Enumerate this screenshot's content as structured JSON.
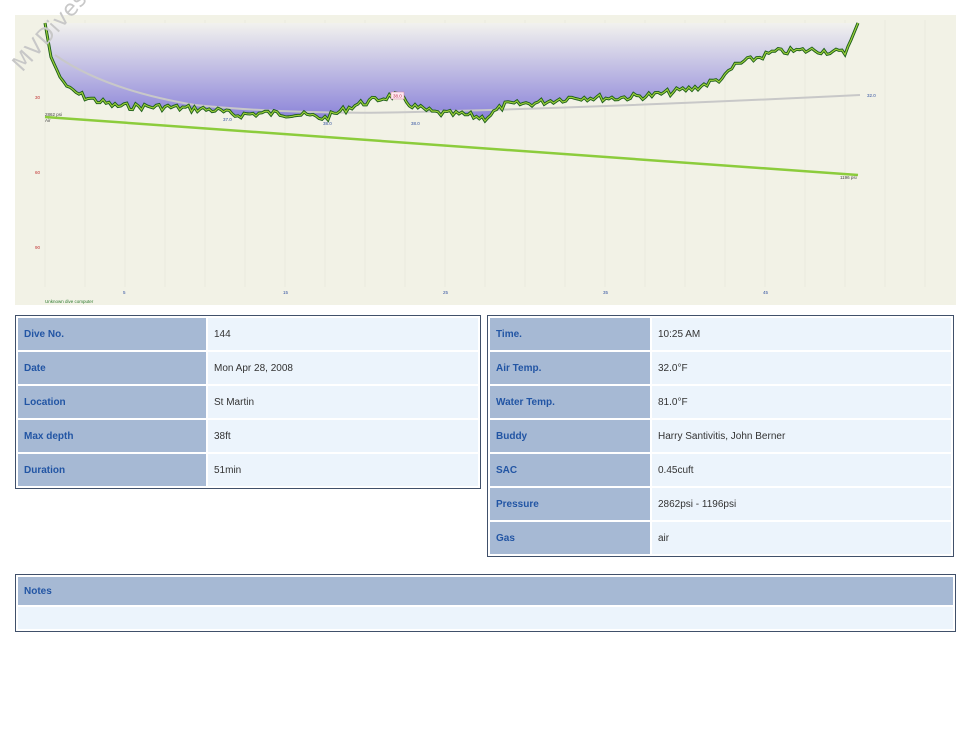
{
  "watermark": "MVDives.com",
  "profile": {
    "depth_labels": [
      "30",
      "60",
      "90"
    ],
    "time_labels": [
      "5",
      "15",
      "25",
      "35",
      "45"
    ],
    "start_pressure": "2862 psi",
    "start_gas": "Air",
    "end_pressure": "1196 psi",
    "temp_labels": [
      "37.0",
      "38.0",
      "38.0"
    ],
    "max_depth_marker": "38.0",
    "end_temp": "32.0",
    "computer": "Unknown dive computer"
  },
  "left_rows": [
    {
      "label": "Dive No.",
      "value": "144"
    },
    {
      "label": "Date",
      "value": "Mon Apr 28, 2008"
    },
    {
      "label": "Location",
      "value": "St Martin"
    },
    {
      "label": "Max depth",
      "value": "38ft"
    },
    {
      "label": "Duration",
      "value": "51min"
    }
  ],
  "right_rows": [
    {
      "label": "Time.",
      "value": "10:25 AM"
    },
    {
      "label": "Air Temp.",
      "value": "32.0°F"
    },
    {
      "label": "Water Temp.",
      "value": "81.0°F"
    },
    {
      "label": "Buddy",
      "value": "Harry Santivitis, John Berner"
    },
    {
      "label": "SAC",
      "value": "0.45cuft"
    },
    {
      "label": "Pressure",
      "value": "2862psi - 1196psi"
    },
    {
      "label": "Gas",
      "value": "air"
    }
  ],
  "notes": {
    "label": "Notes",
    "value": ""
  },
  "colors": {
    "profile_line": "#1a5c1a",
    "profile_highlight": "#9ccf3a",
    "pressure_line": "#8ccc3c",
    "depth_fill": "#8880d8",
    "background": "#f2f2e6",
    "label_bg": "#a6b9d4",
    "value_bg": "#ecf4fc"
  }
}
